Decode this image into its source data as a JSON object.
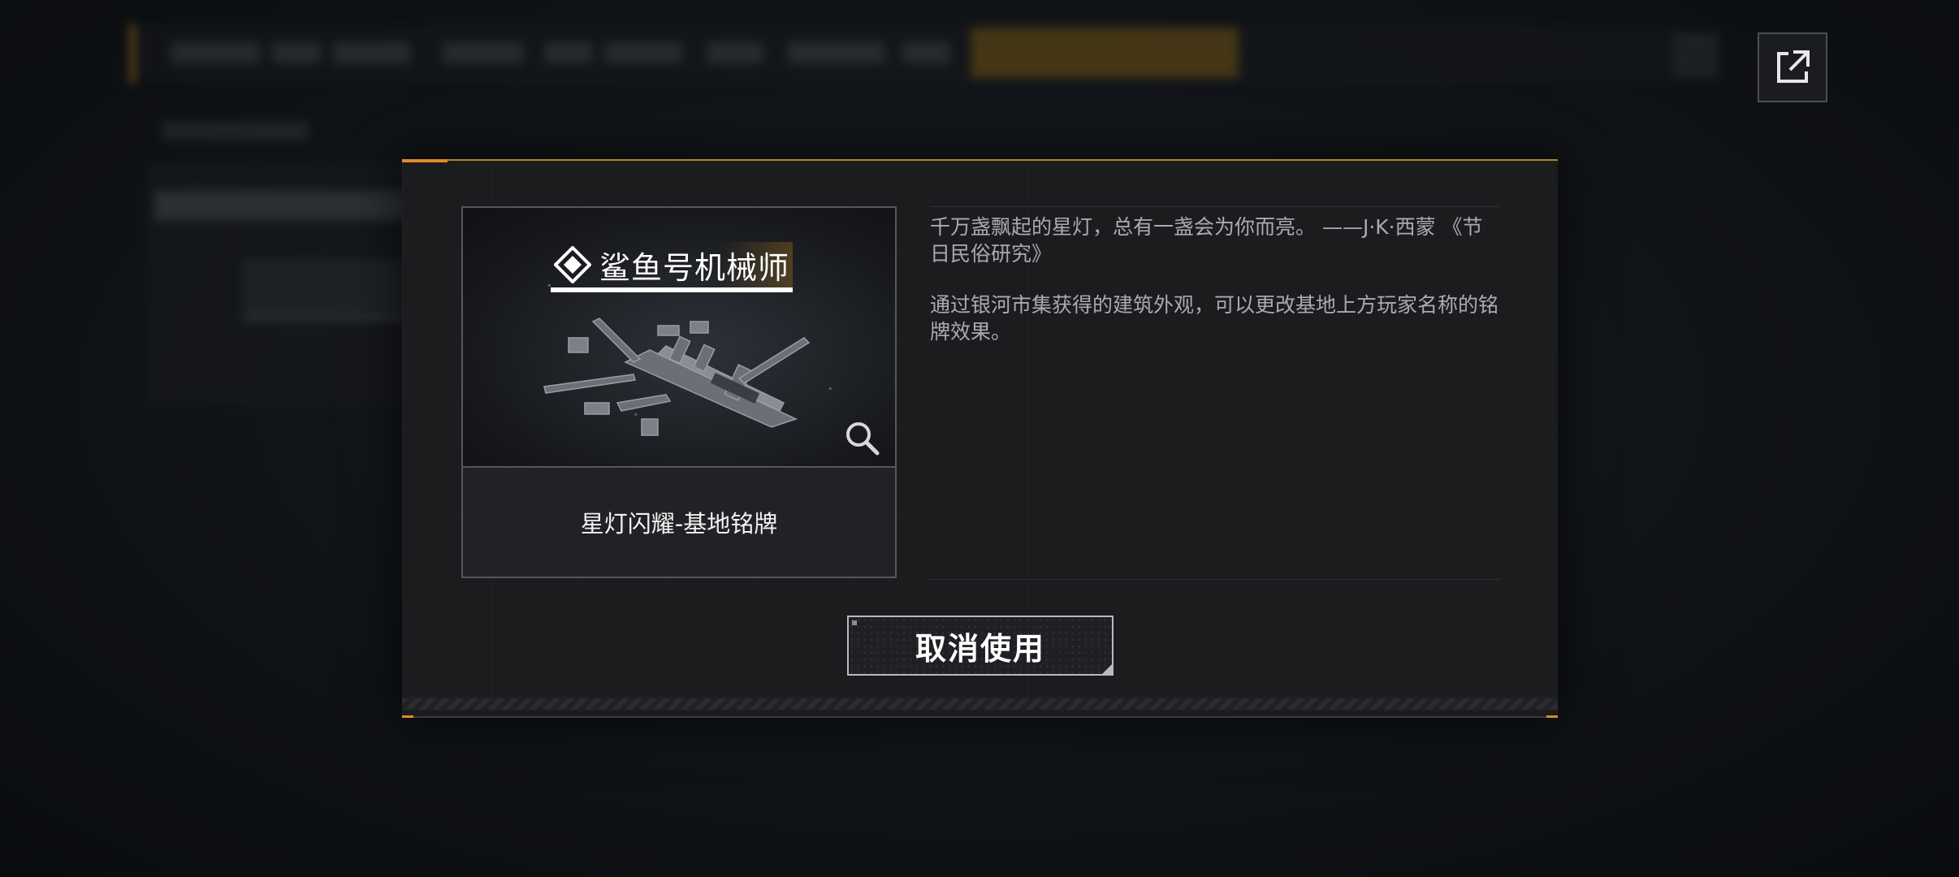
{
  "item": {
    "nameplate_text": "鲨鱼号机械师",
    "name": "星灯闪耀-基地铭牌"
  },
  "description": {
    "quote": "千万盏飘起的星灯，总有一盏会为你而亮。 ——J·K·西蒙 《节日民俗研究》",
    "body": "通过银河市集获得的建筑外观，可以更改基地上方玩家名称的铭牌效果。"
  },
  "actions": {
    "cancel_use_label": "取消使用"
  },
  "icons": {
    "external": "external-link-icon",
    "zoom": "search-icon",
    "nameplate_emblem": "diamond-emblem-icon"
  },
  "colors": {
    "accent": "#e2892a",
    "modal_bg": "#1b1c1e",
    "text_secondary": "#a9abaf"
  }
}
